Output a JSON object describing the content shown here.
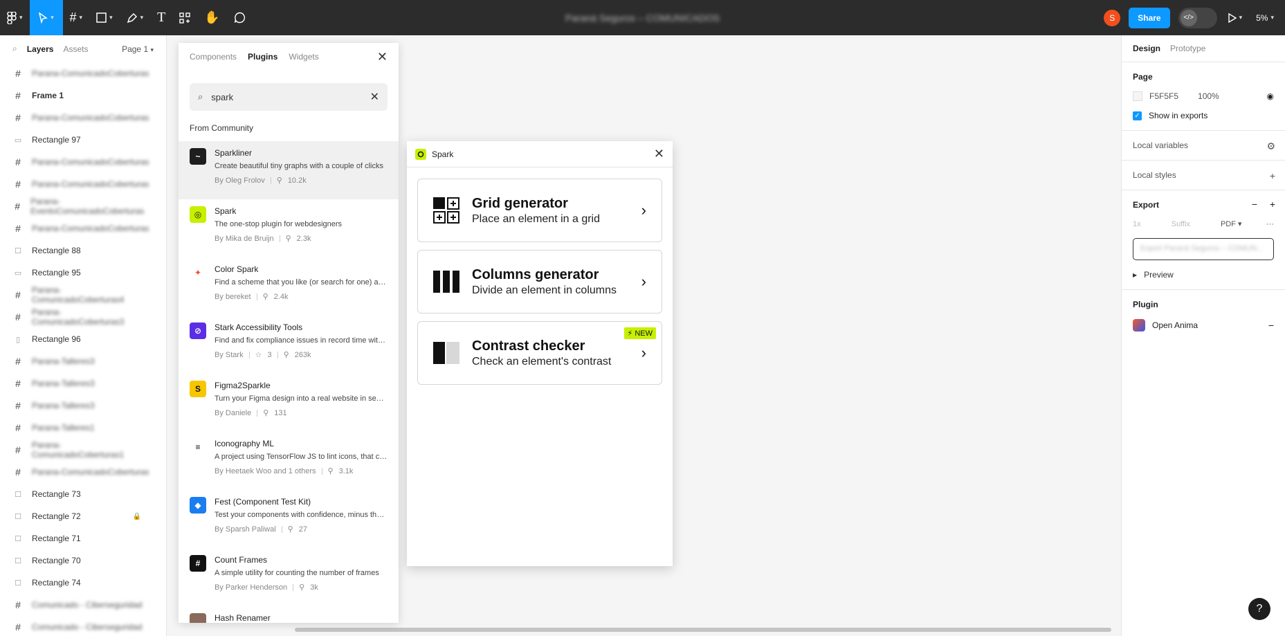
{
  "toolbar": {
    "file_title": "Paraná Seguros – COMUNICADOS",
    "avatar_initial": "S",
    "share_label": "Share",
    "zoom": "5%"
  },
  "left_panel": {
    "tabs": {
      "layers": "Layers",
      "assets": "Assets",
      "page": "Page 1"
    },
    "layers": [
      {
        "icon": "frame",
        "label": "Parana-ComunicadoCoberturas",
        "blurred": true
      },
      {
        "icon": "frame",
        "label": "Frame 1",
        "blurred": false,
        "bold": true
      },
      {
        "icon": "frame",
        "label": "Parana-ComunicadoCoberturas",
        "blurred": true
      },
      {
        "icon": "line",
        "label": "Rectangle 97",
        "blurred": false
      },
      {
        "icon": "frame",
        "label": "Parana-ComunicadoCoberturas",
        "blurred": true
      },
      {
        "icon": "frame",
        "label": "Parana-ComunicadoCoberturas",
        "blurred": true
      },
      {
        "icon": "frame",
        "label": "Parana-EventoComunicadoCoberturas",
        "blurred": true
      },
      {
        "icon": "frame",
        "label": "Parana-ComunicadoCoberturas",
        "blurred": true
      },
      {
        "icon": "rect",
        "label": "Rectangle 88",
        "blurred": false
      },
      {
        "icon": "line",
        "label": "Rectangle 95",
        "blurred": false
      },
      {
        "icon": "frame",
        "label": "Parana-ComunicadoCoberturas4",
        "blurred": true
      },
      {
        "icon": "frame",
        "label": "Parana-ComunicadoCoberturas3",
        "blurred": true
      },
      {
        "icon": "vline",
        "label": "Rectangle 96",
        "blurred": false
      },
      {
        "icon": "frame",
        "label": "Parana-Talleres3",
        "blurred": true
      },
      {
        "icon": "frame",
        "label": "Parana-Talleres3",
        "blurred": true
      },
      {
        "icon": "frame",
        "label": "Parana-Talleres3",
        "blurred": true
      },
      {
        "icon": "frame",
        "label": "Parana-Talleres1",
        "blurred": true
      },
      {
        "icon": "frame",
        "label": "Parana-ComunicadoCoberturas1",
        "blurred": true
      },
      {
        "icon": "frame",
        "label": "Parana-ComunicadoCoberturas",
        "blurred": true
      },
      {
        "icon": "rect",
        "label": "Rectangle 73",
        "blurred": false
      },
      {
        "icon": "rect",
        "label": "Rectangle 72",
        "blurred": false,
        "locked": true
      },
      {
        "icon": "rect",
        "label": "Rectangle 71",
        "blurred": false
      },
      {
        "icon": "rect",
        "label": "Rectangle 70",
        "blurred": false
      },
      {
        "icon": "rect",
        "label": "Rectangle 74",
        "blurred": false
      },
      {
        "icon": "frame",
        "label": "Comunicado - Ciberseguridad",
        "blurred": true
      },
      {
        "icon": "frame",
        "label": "Comunicado - Ciberseguridad",
        "blurred": true
      }
    ]
  },
  "plugin_browser": {
    "tabs": {
      "components": "Components",
      "plugins": "Plugins",
      "widgets": "Widgets"
    },
    "search_value": "spark",
    "section": "From Community",
    "plugins": [
      {
        "name": "Sparkliner",
        "desc": "Create beautiful tiny graphs with a couple of clicks",
        "author": "By Oleg Frolov",
        "users": "10.2k",
        "icon_bg": "#1e1e1e",
        "icon_glyph": "~"
      },
      {
        "name": "Spark",
        "desc": "The one-stop plugin for webdesigners",
        "author": "By Mika de Bruijn",
        "users": "2.3k",
        "icon_bg": "#c6f000",
        "icon_glyph": "◎"
      },
      {
        "name": "Color Spark",
        "desc": "Find a scheme that you like (or search for one) and apply",
        "author": "By bereket",
        "users": "2.4k",
        "icon_bg": "#ffffff",
        "icon_glyph": "✦"
      },
      {
        "name": "Stark Accessibility Tools",
        "desc": "Find and fix compliance issues in record time with Stark",
        "author": "By Stark",
        "stars": "3",
        "users": "263k",
        "icon_bg": "#5b2ee6",
        "icon_glyph": "⊘"
      },
      {
        "name": "Figma2Sparkle",
        "desc": "Turn your Figma design into a real website in seconds",
        "author": "By Daniele",
        "users": "131",
        "icon_bg": "#f6c700",
        "icon_glyph": "S"
      },
      {
        "name": "Iconography ML",
        "desc": "A project using TensorFlow JS to lint icons, that check",
        "author": "By Heetaek Woo and 1 others",
        "users": "3.1k",
        "icon_bg": "#ffffff",
        "icon_glyph": "≡"
      },
      {
        "name": "Fest (Component Test Kit)",
        "desc": "Test your components with confidence, minus the hassle",
        "author": "By Sparsh Paliwal",
        "users": "27",
        "icon_bg": "#1a7df0",
        "icon_glyph": "◆"
      },
      {
        "name": "Count Frames",
        "desc": "A simple utility for counting the number of frames",
        "author": "By Parker Henderson",
        "users": "3k",
        "icon_bg": "#111111",
        "icon_glyph": "#"
      },
      {
        "name": "Hash Renamer",
        "desc": "",
        "author": "",
        "users": "",
        "icon_bg": "#8a6a5a",
        "icon_glyph": ""
      }
    ]
  },
  "spark_window": {
    "title": "Spark",
    "cards": [
      {
        "title": "Grid generator",
        "sub": "Place an element in a grid",
        "badge": ""
      },
      {
        "title": "Columns generator",
        "sub": "Divide an element in columns",
        "badge": ""
      },
      {
        "title": "Contrast checker",
        "sub": "Check an element's contrast",
        "badge": "⚡ NEW"
      }
    ]
  },
  "right_panel": {
    "tabs": {
      "design": "Design",
      "prototype": "Prototype"
    },
    "page": {
      "title": "Page",
      "color": "F5F5F5",
      "opacity": "100%",
      "show_exports": "Show in exports"
    },
    "local_variables": "Local variables",
    "local_styles": "Local styles",
    "export": {
      "title": "Export",
      "scale": "1x",
      "suffix": "Suffix",
      "format": "PDF",
      "button": "Export Paraná Seguros – COMUN...",
      "preview": "Preview"
    },
    "plugin": {
      "title": "Plugin",
      "name": "Open Anima"
    }
  },
  "help_label": "?"
}
